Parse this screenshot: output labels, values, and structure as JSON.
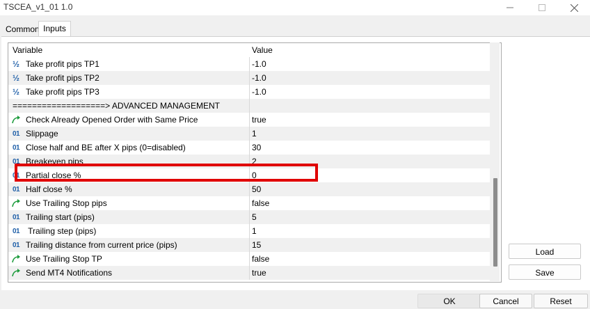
{
  "window": {
    "title": "TSCEA_v1_01 1.0"
  },
  "tabs": [
    {
      "label": "Common",
      "active": false
    },
    {
      "label": "Inputs",
      "active": true
    }
  ],
  "grid": {
    "headers": {
      "variable": "Variable",
      "value": "Value"
    },
    "rows": [
      {
        "icon": "half-icon",
        "variable": "Take profit pips TP1",
        "value": "-1.0"
      },
      {
        "icon": "half-icon",
        "variable": "Take profit pips TP2",
        "value": "-1.0"
      },
      {
        "icon": "half-icon",
        "variable": "Take profit pips TP3",
        "value": "-1.0"
      },
      {
        "icon": "",
        "variable": "===================> ADVANCED MANAGEMENT",
        "value": ""
      },
      {
        "icon": "bool-arrow-icon",
        "variable": "Check Already Opened Order with Same Price",
        "value": "true"
      },
      {
        "icon": "int-icon",
        "variable": "Slippage",
        "value": "1"
      },
      {
        "icon": "int-icon",
        "variable": "Close half and BE after X pips (0=disabled)",
        "value": "30"
      },
      {
        "icon": "int-icon",
        "variable": "Breakeven pips",
        "value": "2"
      },
      {
        "icon": "int-icon",
        "variable": "Partial close %",
        "value": "0"
      },
      {
        "icon": "int-icon",
        "variable": "Half close %",
        "value": "50"
      },
      {
        "icon": "bool-arrow-icon",
        "variable": "Use Trailing Stop pips",
        "value": "false"
      },
      {
        "icon": "int-icon",
        "variable": "Trailing start (pips)",
        "value": "5"
      },
      {
        "icon": "int-icon",
        "variable": " Trailing step (pips)",
        "value": "1"
      },
      {
        "icon": "int-icon",
        "variable": "Trailing distance from current price (pips)",
        "value": "15"
      },
      {
        "icon": "bool-arrow-icon",
        "variable": "Use Trailing Stop TP",
        "value": "false"
      },
      {
        "icon": "bool-arrow-icon",
        "variable": "Send MT4 Notifications",
        "value": "true"
      }
    ]
  },
  "icon_glyphs": {
    "half-icon": "½",
    "int-icon": "01"
  },
  "buttons": {
    "load": "Load",
    "save": "Save",
    "ok": "OK",
    "cancel": "Cancel",
    "reset": "Reset"
  },
  "colors": {
    "highlight": "#e00000",
    "icon_blue": "#1f5fa8",
    "icon_green": "#1a9a3a"
  }
}
